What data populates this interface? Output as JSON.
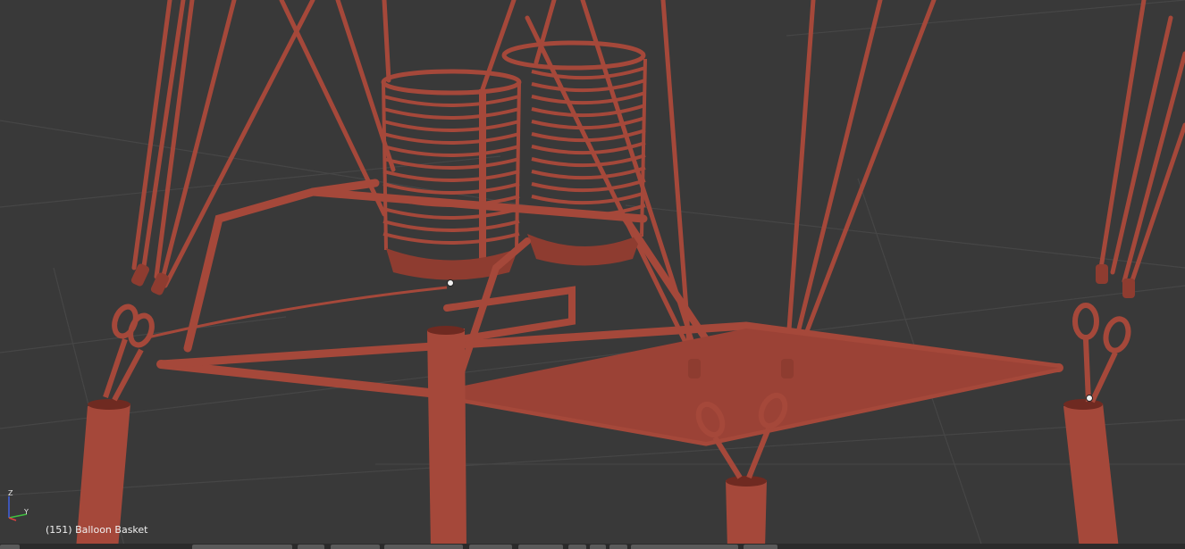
{
  "viewport": {
    "object_label": "(151) Balloon Basket",
    "background_color": "#393939",
    "grid_color": "#474747",
    "model_color": "#a5483a",
    "model_shadow_color": "#6f2a21",
    "model_highlight_color": "#c8665a"
  },
  "axis_gizmo": {
    "z_label": "Z",
    "y_label": "Y",
    "x_color": "#e04040",
    "y_color": "#40c040",
    "z_color": "#4060e0"
  },
  "header": {
    "background_color": "#2b2b2b",
    "button_count_visible": 12
  }
}
